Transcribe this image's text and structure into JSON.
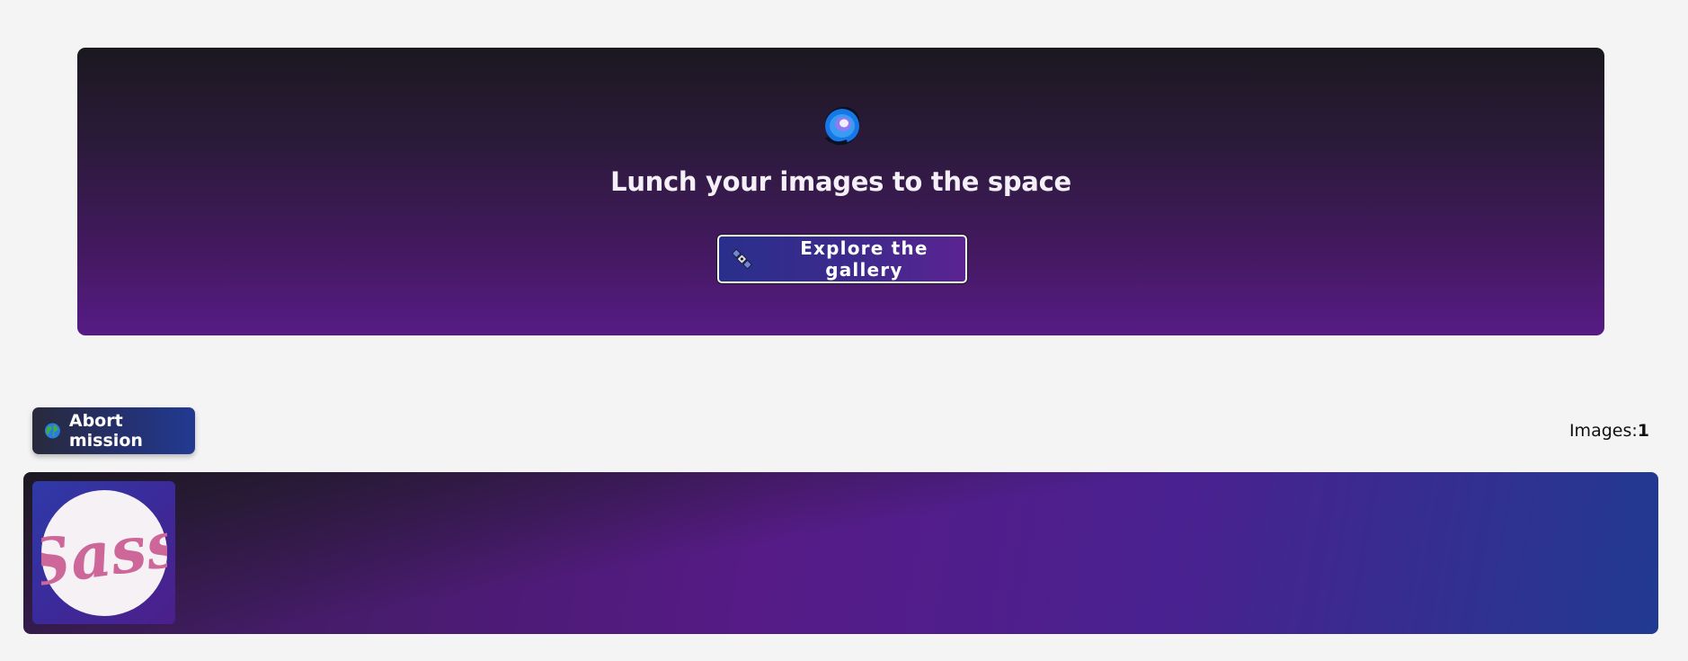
{
  "hero": {
    "title": "Lunch your images to the space",
    "logo_icon": "planet-ring-icon",
    "explore_button": {
      "label": "Explore the gallery",
      "icon": "satellite-icon"
    }
  },
  "toolbar": {
    "abort_button": {
      "label": "Abort mission",
      "icon": "globe-icon"
    },
    "images_label": "Images:",
    "images_count": "1"
  },
  "gallery": {
    "items": [
      {
        "logo_text": "Sass",
        "logo_color": "#cd6799"
      }
    ]
  },
  "colors": {
    "page_background": "#f4f4f5",
    "hero_top": "#1b181f",
    "hero_bottom": "#571b86",
    "accent_blue": "#213a91",
    "sass_pink": "#cd6799"
  }
}
